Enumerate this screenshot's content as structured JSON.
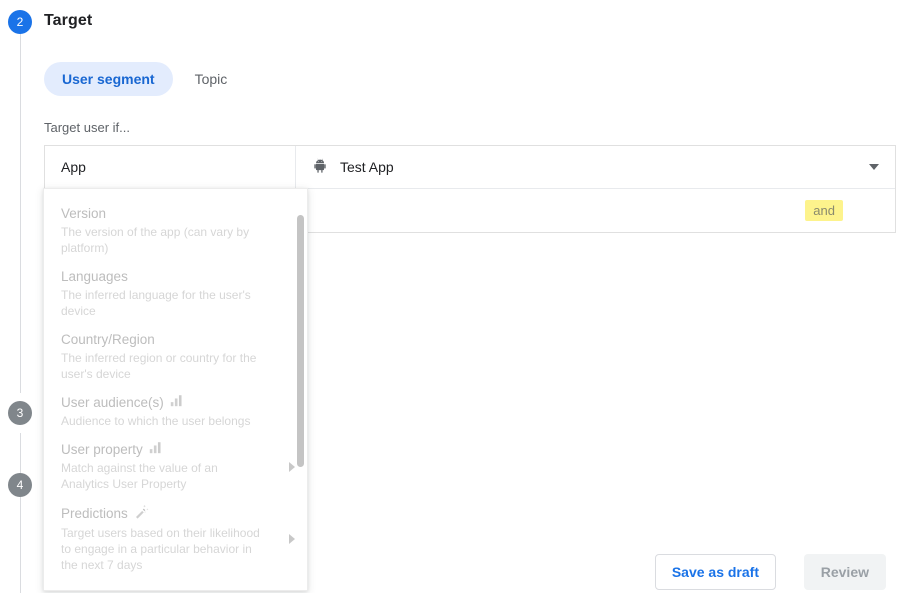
{
  "stepper": {
    "steps": [
      {
        "number": "2",
        "state": "active"
      },
      {
        "number": "3",
        "state": "inactive"
      },
      {
        "number": "4",
        "state": "inactive"
      }
    ],
    "active_color": "#1a73e8",
    "inactive_color": "#80868b"
  },
  "section": {
    "title": "Target"
  },
  "tabs": [
    {
      "label": "User segment",
      "selected": true
    },
    {
      "label": "Topic",
      "selected": false
    }
  ],
  "form": {
    "label": "Target user if...",
    "rows": [
      {
        "left_value": "App",
        "right_icon": "android-icon",
        "right_value": "Test App",
        "has_caret": true
      },
      {
        "left_value": "",
        "right_value": "",
        "chip": "and"
      }
    ]
  },
  "dropdown": {
    "items": [
      {
        "title": "Version",
        "desc": "The version of the app (can vary by platform)",
        "icon": null,
        "submenu": false
      },
      {
        "title": "Languages",
        "desc": "The inferred language for the user's device",
        "icon": null,
        "submenu": false
      },
      {
        "title": "Country/Region",
        "desc": "The inferred region or country for the user's device",
        "icon": null,
        "submenu": false
      },
      {
        "title": "User audience(s)",
        "desc": "Audience to which the user belongs",
        "icon": "analytics-bars-icon",
        "submenu": false
      },
      {
        "title": "User property",
        "desc": "Match against the value of an Analytics User Property",
        "icon": "analytics-bars-icon",
        "submenu": true
      },
      {
        "title": "Predictions",
        "desc": "Target users based on their likelihood to engage in a particular behavior in the next 7 days",
        "icon": "magic-wand-icon",
        "submenu": true
      }
    ]
  },
  "footer": {
    "save_draft_label": "Save as draft",
    "review_label": "Review"
  },
  "colors": {
    "accent": "#1a73e8",
    "tab_selected_bg": "#e3ecfd",
    "tab_selected_text": "#1967d2",
    "chip_bg": "#fdf38c",
    "disabled_bg": "#f1f3f4",
    "disabled_text": "#9aa0a6"
  }
}
